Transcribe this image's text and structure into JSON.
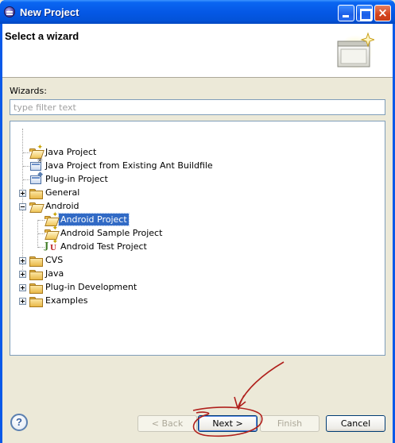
{
  "window": {
    "title": "New Project",
    "controls": {
      "minimize": "",
      "maximize": "",
      "close": "×"
    }
  },
  "header": {
    "title": "Select a wizard"
  },
  "wizards": {
    "label": "Wizards:",
    "filter_placeholder": "type filter text",
    "filter_value": ""
  },
  "tree": {
    "items": [
      {
        "label": "Java Project",
        "icon": "java-project-icon",
        "expander": "none",
        "selected": false
      },
      {
        "label": "Java Project from Existing Ant Buildfile",
        "icon": "ant-project-icon",
        "expander": "none",
        "selected": false
      },
      {
        "label": "Plug-in Project",
        "icon": "plugin-project-icon",
        "expander": "none",
        "selected": false
      },
      {
        "label": "General",
        "icon": "folder-icon",
        "expander": "plus",
        "selected": false
      },
      {
        "label": "Android",
        "icon": "folder-open-icon",
        "expander": "minus",
        "selected": false
      },
      {
        "label": "Android Project",
        "icon": "android-project-icon",
        "expander": "none",
        "selected": true
      },
      {
        "label": "Android Sample Project",
        "icon": "android-sample-project-icon",
        "expander": "none",
        "selected": false
      },
      {
        "label": "Android Test Project",
        "icon": "junit-test-icon",
        "expander": "none",
        "selected": false
      },
      {
        "label": "CVS",
        "icon": "folder-icon",
        "expander": "plus",
        "selected": false
      },
      {
        "label": "Java",
        "icon": "folder-icon",
        "expander": "plus",
        "selected": false
      },
      {
        "label": "Plug-in Development",
        "icon": "folder-icon",
        "expander": "plus",
        "selected": false
      },
      {
        "label": "Examples",
        "icon": "folder-icon",
        "expander": "plus",
        "selected": false
      }
    ]
  },
  "buttons": {
    "help": "?",
    "back": "< Back",
    "next": "Next >",
    "finish": "Finish",
    "cancel": "Cancel"
  },
  "colors": {
    "selection": "#316ac5",
    "titlebar": "#0558e6",
    "annotation": "#b0201c"
  }
}
